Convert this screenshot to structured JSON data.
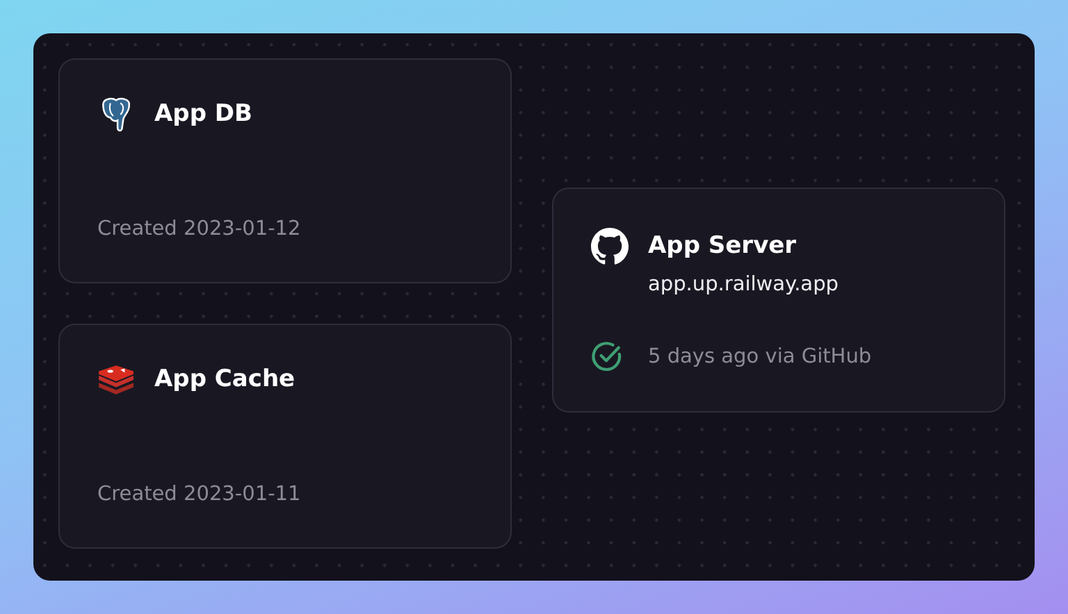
{
  "services": [
    {
      "kind": "database",
      "name": "App DB",
      "created": "Created 2023-01-12"
    },
    {
      "kind": "cache",
      "name": "App Cache",
      "created": "Created 2023-01-11"
    },
    {
      "kind": "service",
      "name": "App Server",
      "url": "app.up.railway.app",
      "deploy": {
        "success": true,
        "text": "5 days ago via GitHub"
      }
    }
  ]
}
